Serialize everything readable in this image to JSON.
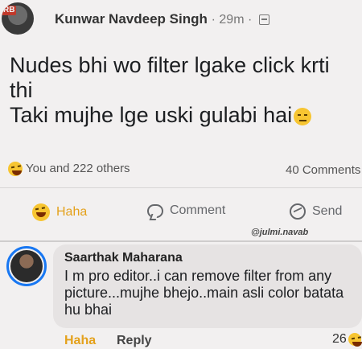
{
  "post": {
    "avatar_badge": "RB",
    "author": "Kunwar Navdeep Singh",
    "time": "29m",
    "line1": "Nudes bhi wo filter lgake click krti",
    "line2": "thi",
    "line3": "Taki mujhe lge uski gulabi hai",
    "reactions": "You and 222 others",
    "comments_count": "40 Comments"
  },
  "actions": {
    "haha": "Haha",
    "comment": "Comment",
    "send": "Send"
  },
  "watermark": "@julmi.navab",
  "comment": {
    "name": "Saarthak Maharana",
    "text": "I m pro editor..i can remove filter from any picture...mujhe bhejo..main asli color batata hu bhai",
    "haha": "Haha",
    "reply": "Reply",
    "reaction_count": "26"
  },
  "icons": [
    "globe-icon",
    "haha-reaction-icon",
    "comment-icon",
    "send-icon",
    "unamused-emoji-icon"
  ],
  "colors": {
    "haha": "#e4a11b",
    "ring": "#1877f2",
    "background": "#f2f0f0"
  }
}
